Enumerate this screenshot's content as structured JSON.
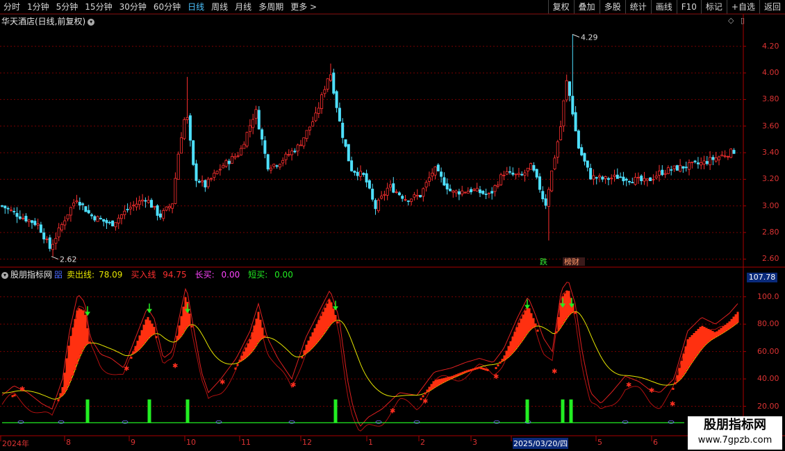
{
  "toolbar": {
    "periods": [
      "分时",
      "1分钟",
      "5分钟",
      "15分钟",
      "30分钟",
      "60分钟",
      "日线",
      "周线",
      "月线",
      "多周期",
      "更多 >"
    ],
    "active_period": "日线",
    "actions": [
      "复权",
      "叠加",
      "多股",
      "统计",
      "画线",
      "F10",
      "标记",
      "+自选",
      "返回"
    ]
  },
  "stock": {
    "title": "华天酒店(日线,前复权)"
  },
  "price_chart": {
    "y_ticks": [
      "4.20",
      "4.00",
      "3.80",
      "3.60",
      "3.40",
      "3.20",
      "3.00",
      "2.80",
      "2.60"
    ],
    "high_label": "4.29",
    "low_label": "2.62",
    "tags": [
      "跌",
      "榜财"
    ]
  },
  "indicator": {
    "name": "股朋指标网",
    "sell_line": {
      "label": "卖出线:",
      "value": "78.09"
    },
    "buy_line": {
      "label": "买入线",
      "value": "94.75"
    },
    "long_buy": {
      "label": "长买:",
      "value": "0.00"
    },
    "short_buy": {
      "label": "短买:",
      "value": "0.00"
    },
    "current_value": "107.78",
    "y_ticks": [
      "100.0",
      "80.00",
      "60.00",
      "40.00",
      "20.00"
    ]
  },
  "date_axis": {
    "labels": [
      "2024年",
      "8",
      "9",
      "10",
      "11",
      "12",
      "1",
      "2",
      "3",
      "2025/03/20/四",
      "5",
      "6"
    ],
    "highlighted": "2025/03/20/四"
  },
  "watermark": {
    "title": "股朋指标网",
    "url": "www.7gpzb.com"
  },
  "colors": {
    "up": "#ff3030",
    "down": "#4ee0ff",
    "signal": "#22ee22",
    "yellow_line": "#e6e600",
    "grid": "#7a0000"
  },
  "chart_data": {
    "type": "candlestick",
    "price_range": [
      2.55,
      4.35
    ],
    "indicator_range": [
      0,
      110
    ],
    "annotations": {
      "high": 4.29,
      "low": 2.62
    }
  }
}
